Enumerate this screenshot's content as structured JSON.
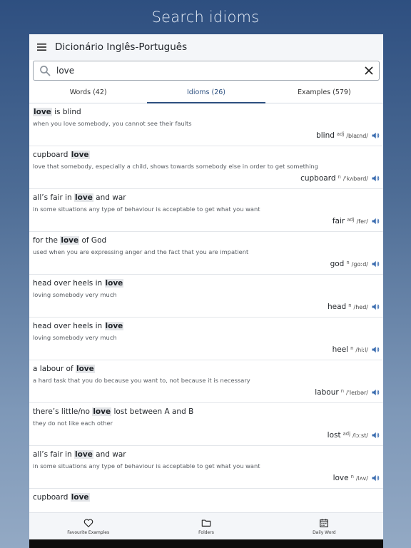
{
  "page_heading": "Search idioms",
  "app": {
    "title": "Dicionário Inglês-Português"
  },
  "search": {
    "value": "love",
    "placeholder": ""
  },
  "tabs": [
    {
      "label": "Words (42)",
      "active": false
    },
    {
      "label": "Idioms (26)",
      "active": true
    },
    {
      "label": "Examples (579)",
      "active": false
    }
  ],
  "results": [
    {
      "before": "",
      "highlight": "love",
      "after": " is blind",
      "definition": "when you love somebody, you cannot see their faults",
      "headword": "blind",
      "pos": "adj",
      "pron": "/blaɪnd/"
    },
    {
      "before": "cupboard ",
      "highlight": "love",
      "after": "",
      "definition": "love that somebody, especially a child, shows towards somebody else in order to get something",
      "headword": "cupboard",
      "pos": "n",
      "pron": "/ˈkʌbərd/"
    },
    {
      "before": "all’s fair in ",
      "highlight": "love",
      "after": " and war",
      "definition": "in some situations any type of behaviour is acceptable to get what you want",
      "headword": "fair",
      "pos": "adj",
      "pron": "/fer/"
    },
    {
      "before": "for the ",
      "highlight": "love",
      "after": " of God",
      "definition": "used when you are expressing anger and the fact that you are impatient",
      "headword": "god",
      "pos": "n",
      "pron": "/ɡɑːd/"
    },
    {
      "before": "head over heels in ",
      "highlight": "love",
      "after": "",
      "definition": "loving somebody very much",
      "headword": "head",
      "pos": "n",
      "pron": "/hed/"
    },
    {
      "before": "head over heels in ",
      "highlight": "love",
      "after": "",
      "definition": "loving somebody very much",
      "headword": "heel",
      "pos": "n",
      "pron": "/hiːl/"
    },
    {
      "before": "a labour of ",
      "highlight": "love",
      "after": "",
      "definition": "a hard task that you do because you want to, not because it is necessary",
      "headword": "labour",
      "pos": "n",
      "pron": "/ˈleɪbər/"
    },
    {
      "before": "there’s little/no ",
      "highlight": "love",
      "after": " lost between A and B",
      "definition": "they do not like each other",
      "headword": "lost",
      "pos": "adj",
      "pron": "/lɔːst/"
    },
    {
      "before": "all’s fair in ",
      "highlight": "love",
      "after": " and war",
      "definition": "in some situations any type of behaviour is acceptable to get what you want",
      "headword": "love",
      "pos": "n",
      "pron": "/lʌv/"
    },
    {
      "before": "cupboard ",
      "highlight": "love",
      "after": "",
      "definition": "",
      "headword": "",
      "pos": "",
      "pron": ""
    }
  ],
  "bottom_nav": [
    {
      "label": "Favourite Examples",
      "icon": "heart-icon"
    },
    {
      "label": "Folders",
      "icon": "folder-icon"
    },
    {
      "label": "Daily Word",
      "icon": "calendar-icon"
    }
  ],
  "colors": {
    "accent": "#2c4f7f",
    "highlight_bg": "#e4e6e9",
    "speaker": "#3b6db0"
  }
}
